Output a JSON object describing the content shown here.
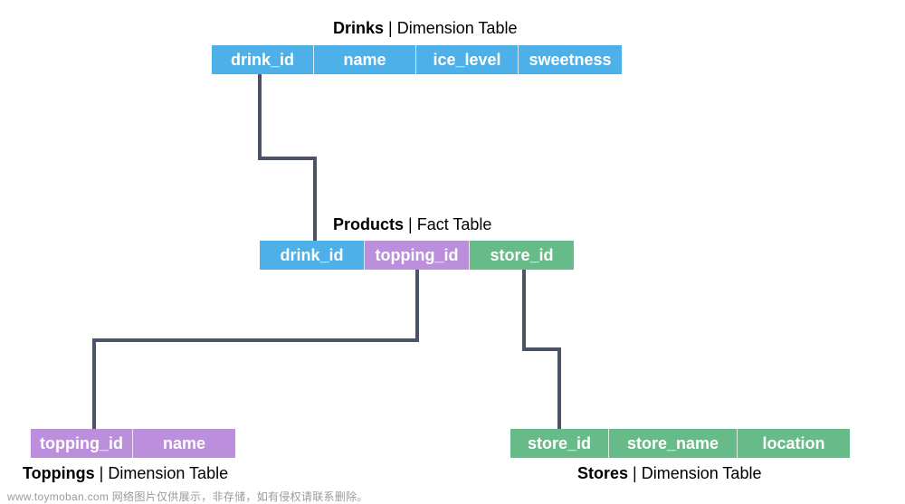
{
  "colors": {
    "drink": "#4db0e8",
    "topping": "#bb8fdc",
    "store": "#66bb88",
    "connector": "#4a5466"
  },
  "tables": {
    "drinks": {
      "name": "Drinks",
      "kind": "| Dimension Table",
      "columns": [
        "drink_id",
        "name",
        "ice_level",
        "sweetness"
      ]
    },
    "products": {
      "name": "Products",
      "kind": "| Fact Table",
      "columns": [
        "drink_id",
        "topping_id",
        "store_id"
      ]
    },
    "toppings": {
      "name": "Toppings",
      "kind": "| Dimension Table",
      "columns": [
        "topping_id",
        "name"
      ]
    },
    "stores": {
      "name": "Stores",
      "kind": "| Dimension Table",
      "columns": [
        "store_id",
        "store_name",
        "location"
      ]
    }
  },
  "relationships": [
    {
      "from": "products.drink_id",
      "to": "drinks.drink_id"
    },
    {
      "from": "products.topping_id",
      "to": "toppings.topping_id"
    },
    {
      "from": "products.store_id",
      "to": "stores.store_id"
    }
  ],
  "watermark": "www.toymoban.com 网络图片仅供展示，非存储，如有侵权请联系删除。"
}
